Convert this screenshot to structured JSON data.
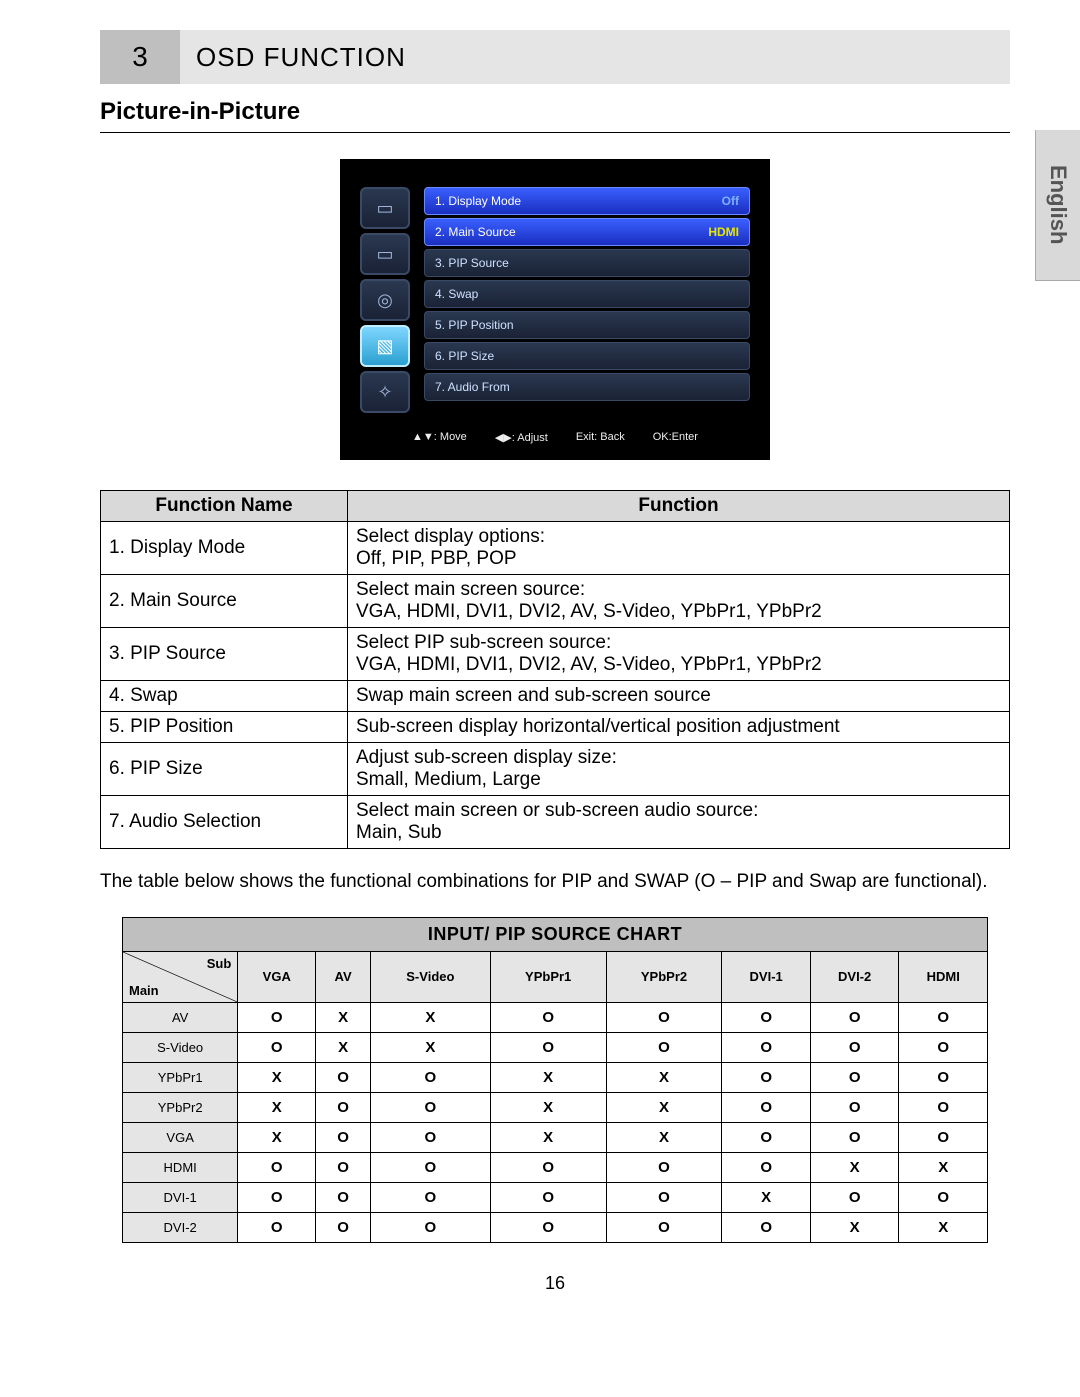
{
  "header": {
    "chapter_number": "3",
    "chapter_title": "OSD FUNCTION"
  },
  "section_title": "Picture-in-Picture",
  "language_tab": "English",
  "osd": {
    "sidebar_glyphs": [
      "▭",
      "▭",
      "◎",
      "▧",
      "✧"
    ],
    "items": [
      {
        "label": "1. Display Mode",
        "value": "Off",
        "value_class": "off",
        "selected": true
      },
      {
        "label": "2. Main Source",
        "value": "HDMI",
        "value_class": "hdmi",
        "selected": true
      },
      {
        "label": "3. PIP Source",
        "value": "",
        "selected": false
      },
      {
        "label": "4. Swap",
        "value": "",
        "selected": false
      },
      {
        "label": "5. PIP Position",
        "value": "",
        "selected": false
      },
      {
        "label": "6. PIP Size",
        "value": "",
        "selected": false
      },
      {
        "label": "7. Audio From",
        "value": "",
        "selected": false
      }
    ],
    "nav": {
      "move": "▲▼: Move",
      "adjust": "◀▶: Adjust",
      "exit": "Exit: Back",
      "ok": "OK:Enter"
    }
  },
  "func_table": {
    "headers": [
      "Function Name",
      "Function"
    ],
    "rows": [
      {
        "name": "1. Display Mode",
        "desc": "Select display options:\nOff, PIP, PBP, POP"
      },
      {
        "name": "2. Main Source",
        "desc": "Select main screen source:\nVGA, HDMI, DVI1, DVI2, AV, S-Video, YPbPr1, YPbPr2"
      },
      {
        "name": "3. PIP Source",
        "desc": "Select PIP sub-screen source:\nVGA, HDMI, DVI1, DVI2, AV, S-Video, YPbPr1, YPbPr2"
      },
      {
        "name": "4. Swap",
        "desc": "Swap main screen and sub-screen source"
      },
      {
        "name": "5. PIP Position",
        "desc": "Sub-screen display horizontal/vertical position adjustment"
      },
      {
        "name": "6. PIP Size",
        "desc": "Adjust sub-screen display size:\nSmall, Medium, Large"
      },
      {
        "name": "7. Audio Selection",
        "desc": "Select main screen or sub-screen audio source:\nMain, Sub"
      }
    ]
  },
  "paragraph": "The table below shows the functional combinations for PIP and SWAP (O – PIP and Swap are functional).",
  "matrix": {
    "title": "INPUT/ PIP SOURCE CHART",
    "corner": {
      "sub": "Sub",
      "main": "Main"
    },
    "cols": [
      "VGA",
      "AV",
      "S-Video",
      "YPbPr1",
      "YPbPr2",
      "DVI-1",
      "DVI-2",
      "HDMI"
    ],
    "rows": [
      {
        "label": "AV",
        "cells": [
          "O",
          "X",
          "X",
          "O",
          "O",
          "O",
          "O",
          "O"
        ]
      },
      {
        "label": "S-Video",
        "cells": [
          "O",
          "X",
          "X",
          "O",
          "O",
          "O",
          "O",
          "O"
        ]
      },
      {
        "label": "YPbPr1",
        "cells": [
          "X",
          "O",
          "O",
          "X",
          "X",
          "O",
          "O",
          "O"
        ]
      },
      {
        "label": "YPbPr2",
        "cells": [
          "X",
          "O",
          "O",
          "X",
          "X",
          "O",
          "O",
          "O"
        ]
      },
      {
        "label": "VGA",
        "cells": [
          "X",
          "O",
          "O",
          "X",
          "X",
          "O",
          "O",
          "O"
        ]
      },
      {
        "label": "HDMI",
        "cells": [
          "O",
          "O",
          "O",
          "O",
          "O",
          "O",
          "X",
          "X"
        ]
      },
      {
        "label": "DVI-1",
        "cells": [
          "O",
          "O",
          "O",
          "O",
          "O",
          "X",
          "O",
          "O"
        ]
      },
      {
        "label": "DVI-2",
        "cells": [
          "O",
          "O",
          "O",
          "O",
          "O",
          "O",
          "X",
          "X"
        ]
      }
    ]
  },
  "page_number": "16"
}
